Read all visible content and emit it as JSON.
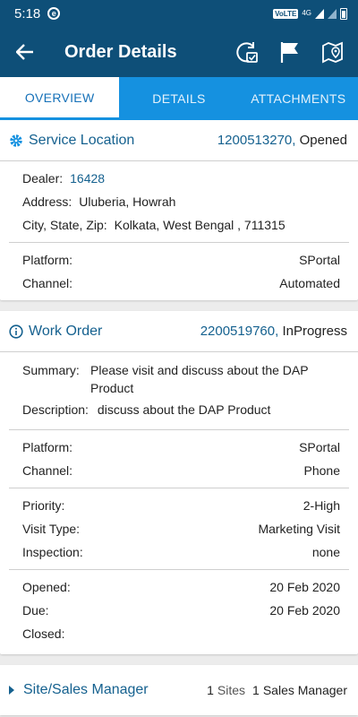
{
  "status_bar": {
    "time": "5:18",
    "app_indicator": "e",
    "volte": "VoLTE",
    "network": "4G"
  },
  "app_bar": {
    "title": "Order Details",
    "icons": [
      "back-arrow-icon",
      "refresh-check-icon",
      "flag-icon",
      "map-marker-icon"
    ]
  },
  "tabs": [
    {
      "label": "OVERVIEW",
      "active": true
    },
    {
      "label": "DETAILS",
      "active": false
    },
    {
      "label": "ATTACHMENTS",
      "active": false
    }
  ],
  "service_location": {
    "title": "Service Location",
    "number": "1200513270,",
    "status": "Opened",
    "dealer_label": "Dealer:",
    "dealer_value": "16428",
    "address_label": "Address:",
    "address_value": "Uluberia, Howrah",
    "city_label": "City, State, Zip:",
    "city_value": "Kolkata,  West Bengal ,  711315",
    "platform_label": "Platform:",
    "platform_value": "SPortal",
    "channel_label": "Channel:",
    "channel_value": "Automated"
  },
  "work_order": {
    "title": "Work Order",
    "number": "2200519760,",
    "status": "InProgress",
    "summary_label": "Summary:",
    "summary_value": "Please visit and discuss about the DAP Product",
    "description_label": "Description:",
    "description_value": "discuss about the DAP Product",
    "platform_label": "Platform:",
    "platform_value": "SPortal",
    "channel_label": "Channel:",
    "channel_value": "Phone",
    "priority_label": "Priority:",
    "priority_value": "2-High",
    "visit_type_label": "Visit Type:",
    "visit_type_value": "Marketing Visit",
    "inspection_label": "Inspection:",
    "inspection_value": "none",
    "opened_label": "Opened:",
    "opened_value": "20 Feb 2020",
    "due_label": "Due:",
    "due_value": "20 Feb 2020",
    "closed_label": "Closed:",
    "closed_value": ""
  },
  "site_sales": {
    "title": "Site/Sales Manager",
    "sites_count": "1",
    "sites_label": "Sites",
    "managers_count": "1",
    "managers_label": "Sales Manager"
  }
}
